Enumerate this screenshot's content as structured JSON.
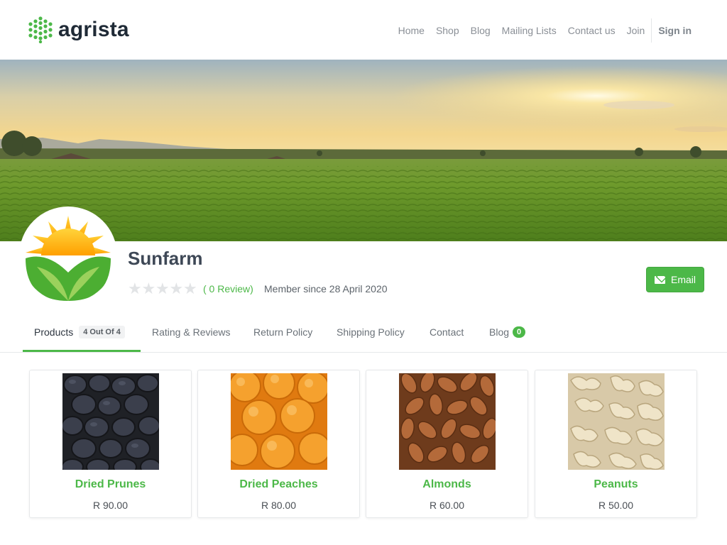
{
  "brand": {
    "name": "agrista",
    "accent": "#4cb848"
  },
  "nav": {
    "items": [
      "Home",
      "Shop",
      "Blog",
      "Mailing Lists",
      "Contact us",
      "Join"
    ],
    "sign_in": "Sign in"
  },
  "profile": {
    "name": "Sunfarm",
    "rating": 0,
    "max_rating": 5,
    "review_text": "( 0 Review)",
    "member_since": "Member since 28 April 2020",
    "email_button": "Email"
  },
  "tabs": {
    "products": {
      "label": "Products",
      "badge": "4 Out Of 4"
    },
    "ratings": {
      "label": "Rating & Reviews"
    },
    "return_policy": {
      "label": "Return Policy"
    },
    "shipping_policy": {
      "label": "Shipping Policy"
    },
    "contact": {
      "label": "Contact"
    },
    "blog": {
      "label": "Blog",
      "badge": "0"
    }
  },
  "products": [
    {
      "name": "Dried Prunes",
      "price": "R 90.00"
    },
    {
      "name": "Dried Peaches",
      "price": "R 80.00"
    },
    {
      "name": "Almonds",
      "price": "R 60.00"
    },
    {
      "name": "Peanuts",
      "price": "R 50.00"
    }
  ]
}
